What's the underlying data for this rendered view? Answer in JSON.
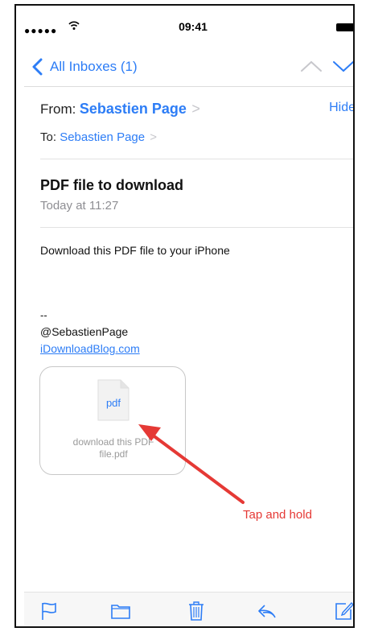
{
  "status_bar": {
    "signal": "●●●●●",
    "time": "09:41"
  },
  "nav": {
    "back_label": "All Inboxes (1)",
    "icons": [
      "chevron-left-icon",
      "chevron-up-icon",
      "chevron-down-icon"
    ]
  },
  "header": {
    "from_label": "From:",
    "from_name": "Sebastien Page",
    "hide_label": "Hide",
    "to_label": "To:",
    "to_name": "Sebastien Page",
    "chevron": ">"
  },
  "message": {
    "subject": "PDF file to download",
    "date": "Today at 11:27",
    "body": "Download this PDF file to your iPhone",
    "signature_dash": "--",
    "signature_handle": "@SebastienPage",
    "signature_link": "iDownloadBlog.com"
  },
  "attachment": {
    "icon_label": "pdf",
    "filename_line1": "download this PDF",
    "filename_line2": "file.pdf"
  },
  "annotation": {
    "label": "Tap and hold",
    "color": "#e53935"
  },
  "toolbar": {
    "icons": [
      "flag-icon",
      "folder-icon",
      "trash-icon",
      "reply-icon",
      "compose-icon"
    ]
  },
  "colors": {
    "accent": "#2d7df6",
    "secondary_text": "#8e8e93"
  }
}
